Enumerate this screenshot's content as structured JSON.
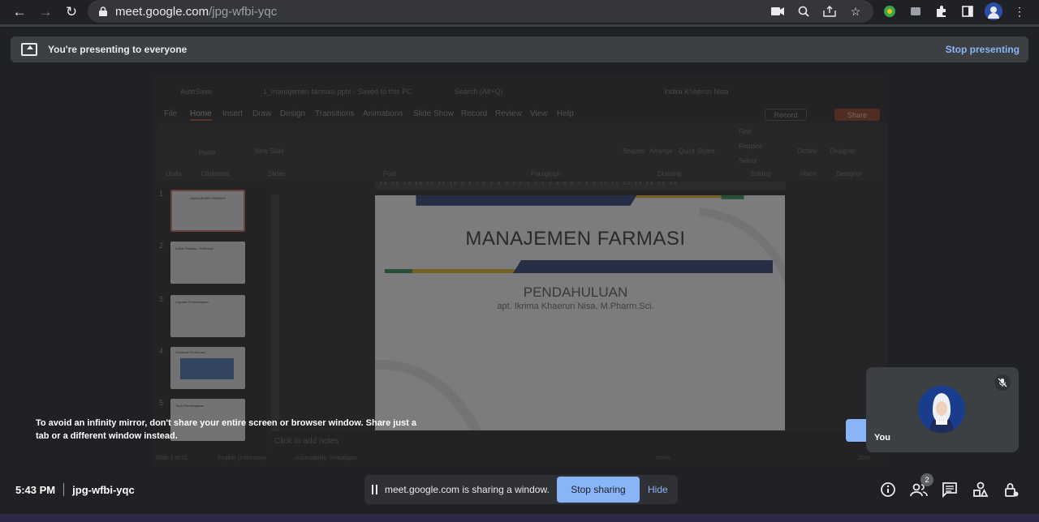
{
  "browser": {
    "url_host": "meet.google.com",
    "url_path": "/jpg-wfbi-yqc"
  },
  "banner": {
    "message": "You're presenting to everyone",
    "stop_label": "Stop presenting"
  },
  "shared_window": {
    "app_title": "1_manajemen farmasi.pptx - Saved to this PC",
    "search_placeholder": "Search (Alt+Q)",
    "user_name": "Indira Khaerun Nisa",
    "autosave_label": "AutoSave",
    "menu": [
      "File",
      "Home",
      "Insert",
      "Draw",
      "Design",
      "Transitions",
      "Animations",
      "Slide Show",
      "Record",
      "Review",
      "View",
      "Help"
    ],
    "active_menu": "Home",
    "record_label": "Record",
    "share_label": "Share",
    "ribbon_groups": [
      "Undo",
      "Clipboard",
      "Slides",
      "Font",
      "Paragraph",
      "Drawing",
      "Editing",
      "Voice",
      "Designer"
    ],
    "ribbon_labels": {
      "paste": "Paste",
      "new_slide": "New Slide",
      "shapes": "Shapes",
      "arrange": "Arrange",
      "quick_styles": "Quick Styles",
      "find": "Find",
      "replace": "Replace",
      "select": "Select",
      "dictate": "Dictate",
      "designer": "Designer"
    },
    "thumbnail_numbers": [
      "1",
      "2",
      "3",
      "4",
      "5"
    ],
    "thumbnail_titles": [
      "MANAJEMEN FARMASI",
      "Daftar Pustaka / Referensi",
      "Capaian Pembelajaran",
      "Distribusi Pertemuan",
      "Topik Pembelajaran"
    ],
    "ruler_ticks": "16 15 14 13 12 11 10 9 8 7 6 5 4 3 2 1 0 1 2 3 4 5 6 7 8 9 10 11 12 13 14 15 16",
    "slide": {
      "title": "MANAJEMEN FARMASI",
      "subtitle": "PENDAHULUAN",
      "author": "apt. Ikrima Khaerun Nisa, M.Pharm.Sci."
    },
    "notes_placeholder": "Click to add notes",
    "status": {
      "slide_count": "Slide 1 of 31",
      "language": "English (Indonesia)",
      "accessibility": "Accessibility: Investigate",
      "notes": "Notes",
      "zoom": "50%"
    }
  },
  "mirror_warning": "To avoid an infinity mirror, don't share your entire screen or browser window. Share just a tab or a different window instead.",
  "self_tile": {
    "name": "You"
  },
  "bottom_bar": {
    "time": "5:43 PM",
    "meeting_code": "jpg-wfbi-yqc",
    "share_status": "meet.google.com is sharing a window.",
    "stop_sharing_label": "Stop sharing",
    "hide_label": "Hide",
    "people_count": "2"
  },
  "colors": {
    "accent_blue": "#8ab4f8",
    "background": "#202124",
    "surface": "#3c4043"
  }
}
